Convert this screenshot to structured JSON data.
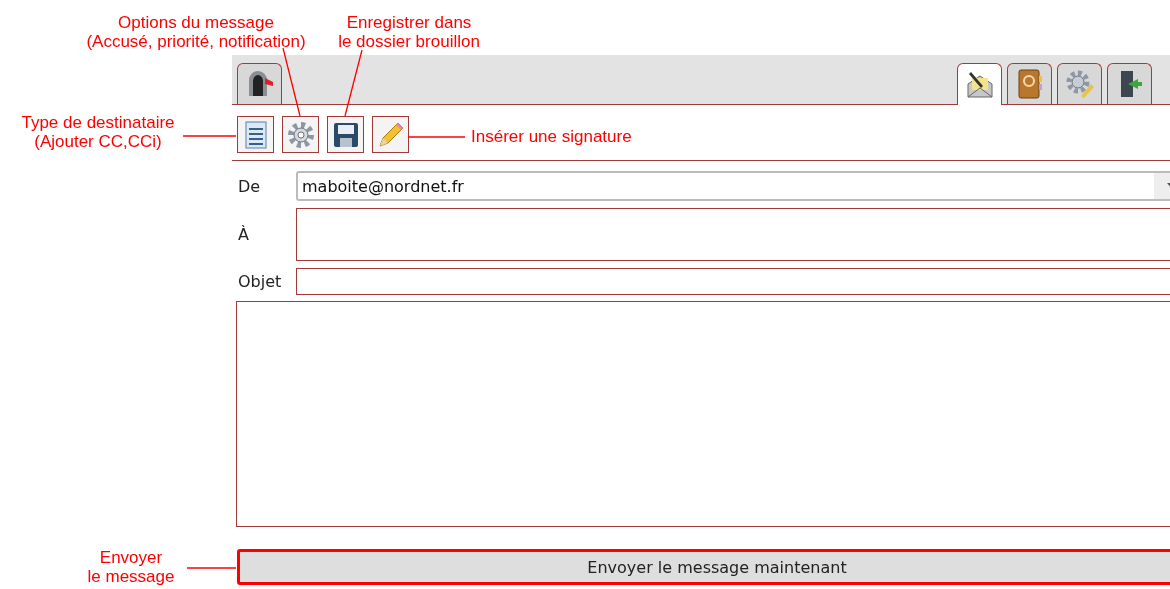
{
  "annotations": [
    {
      "kind": "options",
      "text": "Options du message\n(Accusé, priorité, notification)"
    },
    {
      "kind": "save",
      "text": "Enregistrer dans\nle dossier brouillon"
    },
    {
      "kind": "recipients",
      "text": "Type de destinataire\n(Ajouter CC,CCi)"
    },
    {
      "kind": "signature",
      "text": "Insérer une signature"
    },
    {
      "kind": "send",
      "text": "Envoyer\nle message"
    }
  ],
  "left_tabs": [
    {
      "kind": "mailbox",
      "selected": false
    }
  ],
  "right_tabs": [
    {
      "kind": "compose",
      "selected": true
    },
    {
      "kind": "contacts",
      "selected": false
    },
    {
      "kind": "settings",
      "selected": false
    },
    {
      "kind": "logout",
      "selected": false
    }
  ],
  "toolbar": [
    {
      "kind": "recipients"
    },
    {
      "kind": "options"
    },
    {
      "kind": "save"
    },
    {
      "kind": "signature"
    }
  ],
  "form": {
    "from_label": "De",
    "from_value": "maboite@nordnet.fr",
    "to_label": "À",
    "subject_label": "Objet"
  },
  "send_button": "Envoyer le message maintenant"
}
